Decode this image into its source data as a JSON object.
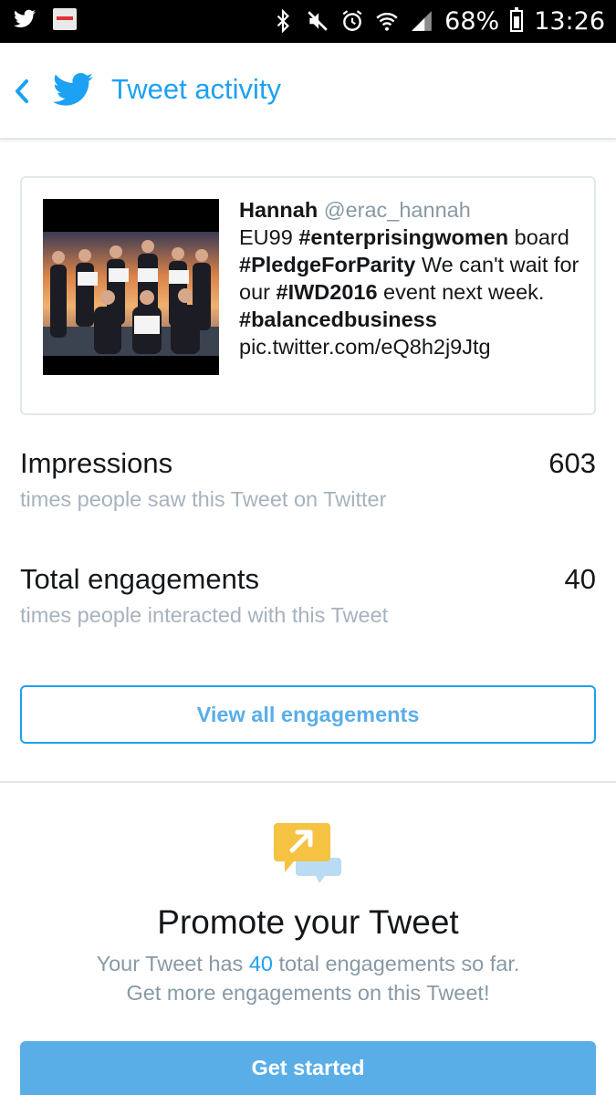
{
  "status_bar": {
    "battery": "68%",
    "time": "13:26",
    "left_icons": [
      "twitter-bird-icon",
      "app-notification-icon"
    ],
    "right_icons": [
      "bluetooth-icon",
      "mute-icon",
      "alarm-icon",
      "wifi-icon",
      "signal-icon",
      "battery-icon"
    ]
  },
  "header": {
    "title": "Tweet activity",
    "back_icon": "chevron-left-icon",
    "logo_icon": "twitter-bird-icon"
  },
  "tweet": {
    "author": "Hannah",
    "handle": "@erac_hannah",
    "text_parts": {
      "p1": "EU99 ",
      "tag1": "#enterprisingwomen",
      "p2": " board ",
      "tag2": "#PledgeForParity",
      "p3": " We can't wait for our ",
      "tag3": "#IWD2016",
      "p4": " event next week. ",
      "tag4": "#balancedbusiness",
      "p5": " pic.twitter.com/eQ8h2j9Jtg"
    }
  },
  "stats": {
    "impressions": {
      "label": "Impressions",
      "value": "603",
      "description": "times people saw this Tweet on Twitter"
    },
    "engagements": {
      "label": "Total engagements",
      "value": "40",
      "description": "times people interacted with this Tweet"
    }
  },
  "view_all_button": "View all engagements",
  "promote": {
    "icon": "promote-chat-arrow-icon",
    "title": "Promote your Tweet",
    "desc_before": "Your Tweet has ",
    "desc_count": "40",
    "desc_after": " total engagements so far.",
    "desc_line2": "Get more engagements on this Tweet!",
    "button": "Get started"
  },
  "colors": {
    "accent": "#1da1f2",
    "button_fill": "#5aaee8",
    "muted_text": "#8899a6",
    "promote_icon": "#f5c242"
  }
}
